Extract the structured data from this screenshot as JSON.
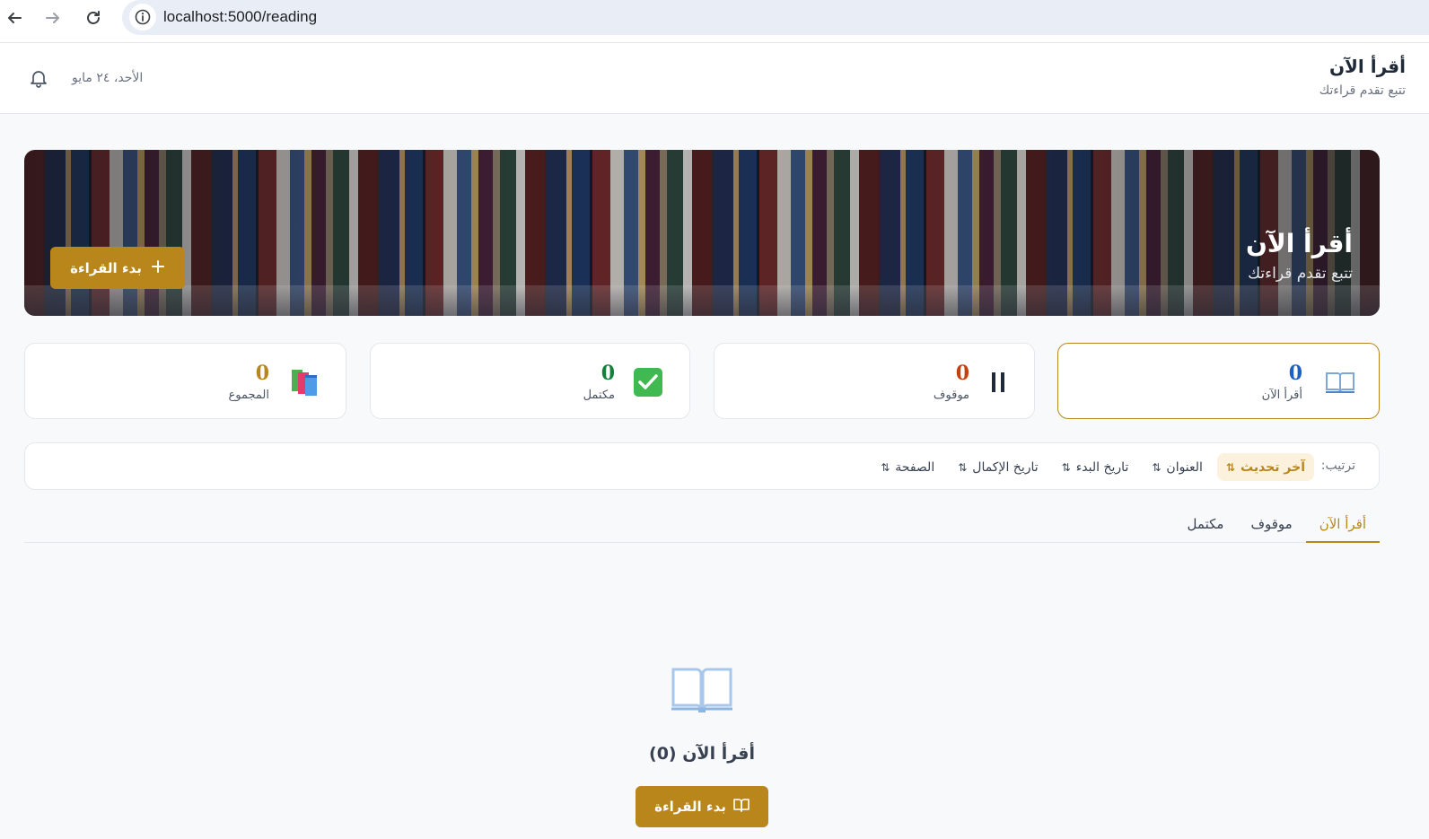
{
  "browser": {
    "url": "localhost:5000/reading",
    "icons": [
      "back-arrow-icon",
      "forward-arrow-icon",
      "reload-icon",
      "site-info-icon"
    ]
  },
  "header": {
    "title": "أقرأ الآن",
    "subtitle": "تتبع تقدم قراءتك",
    "date": "الأحد، ٢٤ مايو",
    "bell_icon": "bell-icon"
  },
  "hero": {
    "title": "أقرأ الآن",
    "subtitle": "تتبع تقدم قراءتك",
    "button_label": "بدء القراءة",
    "button_icon": "plus-icon"
  },
  "stats": [
    {
      "label": "أقرأ الآن",
      "value": "0",
      "icon": "open-book-icon",
      "color": "#1f5fbf",
      "active": true
    },
    {
      "label": "موقوف",
      "value": "0",
      "icon": "pause-icon",
      "color": "#c2410c",
      "active": false
    },
    {
      "label": "مكتمل",
      "value": "0",
      "icon": "check-mark-icon",
      "color": "#15803d",
      "active": false
    },
    {
      "label": "المجموع",
      "value": "0",
      "icon": "books-stack-icon",
      "color": "#b8861b",
      "active": false
    }
  ],
  "sort": {
    "label": "ترتيب:",
    "arrow": "⇅",
    "options": [
      "آخر تحديث",
      "العنوان",
      "تاريخ البدء",
      "تاريخ الإكمال",
      "الصفحة"
    ],
    "active_index": 0
  },
  "tabs": {
    "items": [
      "أقرأ الآن",
      "موقوف",
      "مكتمل"
    ],
    "active_index": 0
  },
  "empty_state": {
    "title": "أقرأ الآن (0)",
    "button_label": "بدء القراءة",
    "icon": "open-book-icon",
    "button_icon": "book-outline-icon"
  },
  "colors": {
    "accent": "#b8861b",
    "accent_soft": "#fbf1dd",
    "background": "#f8f9fb"
  }
}
